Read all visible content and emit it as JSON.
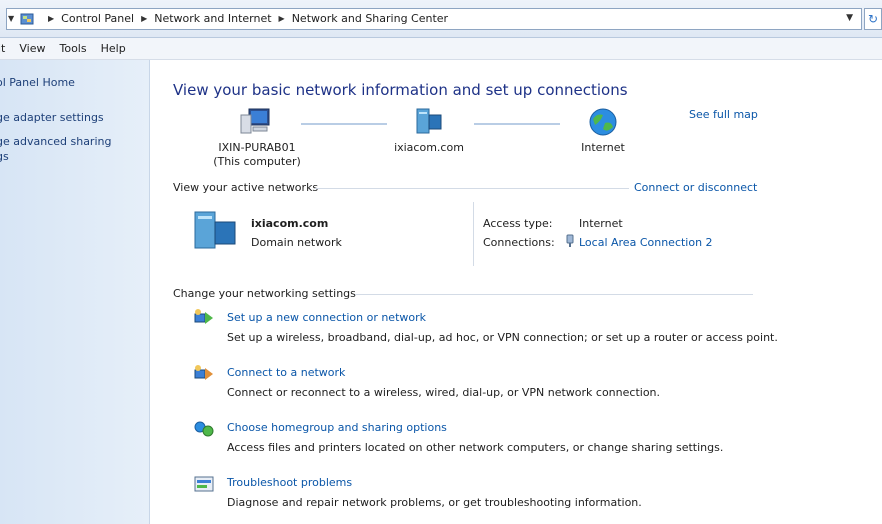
{
  "address": {
    "crumbs": [
      "Control Panel",
      "Network and Internet",
      "Network and Sharing Center"
    ]
  },
  "menu": [
    "it",
    "View",
    "Tools",
    "Help"
  ],
  "left_pane": {
    "items": [
      {
        "text": "ol Panel Home"
      },
      {
        "text": "ge adapter settings"
      },
      {
        "text": "ge advanced sharing"
      },
      {
        "text": "gs"
      }
    ]
  },
  "main": {
    "title": "View your basic network information and set up connections",
    "see_full_map": "See full map",
    "map": {
      "computer_name": "IXIN-PURAB01",
      "computer_note": "(This computer)",
      "domain_node": "ixiacom.com",
      "internet_node": "Internet"
    },
    "active_networks": {
      "header": "View your active networks",
      "connect_link": "Connect or disconnect",
      "network_name": "ixiacom.com",
      "network_type": "Domain network",
      "access_type_label": "Access type:",
      "access_type_value": "Internet",
      "connections_label": "Connections:",
      "connections_value": "Local Area Connection 2"
    },
    "change_settings": {
      "header": "Change your networking settings",
      "tasks": [
        {
          "link": "Set up a new connection or network",
          "desc": "Set up a wireless, broadband, dial-up, ad hoc, or VPN connection; or set up a router or access point."
        },
        {
          "link": "Connect to a network",
          "desc": "Connect or reconnect to a wireless, wired, dial-up, or VPN network connection."
        },
        {
          "link": "Choose homegroup and sharing options",
          "desc": "Access files and printers located on other network computers, or change sharing settings."
        },
        {
          "link": "Troubleshoot problems",
          "desc": "Diagnose and repair network problems, or get troubleshooting information."
        }
      ]
    }
  }
}
